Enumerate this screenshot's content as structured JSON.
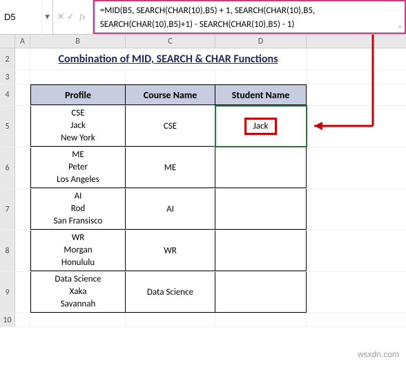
{
  "nameBox": "D5",
  "formula": "=MID(B5, SEARCH(CHAR(10),B5) + 1, SEARCH(CHAR(10),B5, SEARCH(CHAR(10),B5)+1) - SEARCH(CHAR(10),B5) - 1)",
  "fxLabel": "fx",
  "columns": {
    "A": "A",
    "B": "B",
    "C": "C",
    "D": "D"
  },
  "rowLabels": [
    "2",
    "3",
    "4",
    "5",
    "6",
    "7",
    "8",
    "9",
    "10"
  ],
  "title": "Combination of MID, SEARCH & CHAR Functions",
  "headers": {
    "profile": "Profile",
    "course": "Course Name",
    "student": "Student Name"
  },
  "rows": [
    {
      "profile": "CSE\nJack\nNew York",
      "course": "CSE",
      "student": "Jack"
    },
    {
      "profile": "ME\nPeter\nLos Angeles",
      "course": "ME",
      "student": ""
    },
    {
      "profile": "AI\nRod\nSan Fransisco",
      "course": "AI",
      "student": ""
    },
    {
      "profile": "WR\nMorgan\nHonululu",
      "course": "WR",
      "student": ""
    },
    {
      "profile": "Data Science\nXaka\nSavannah",
      "course": "Data Science",
      "student": ""
    }
  ],
  "watermark": "wsxdn.com"
}
